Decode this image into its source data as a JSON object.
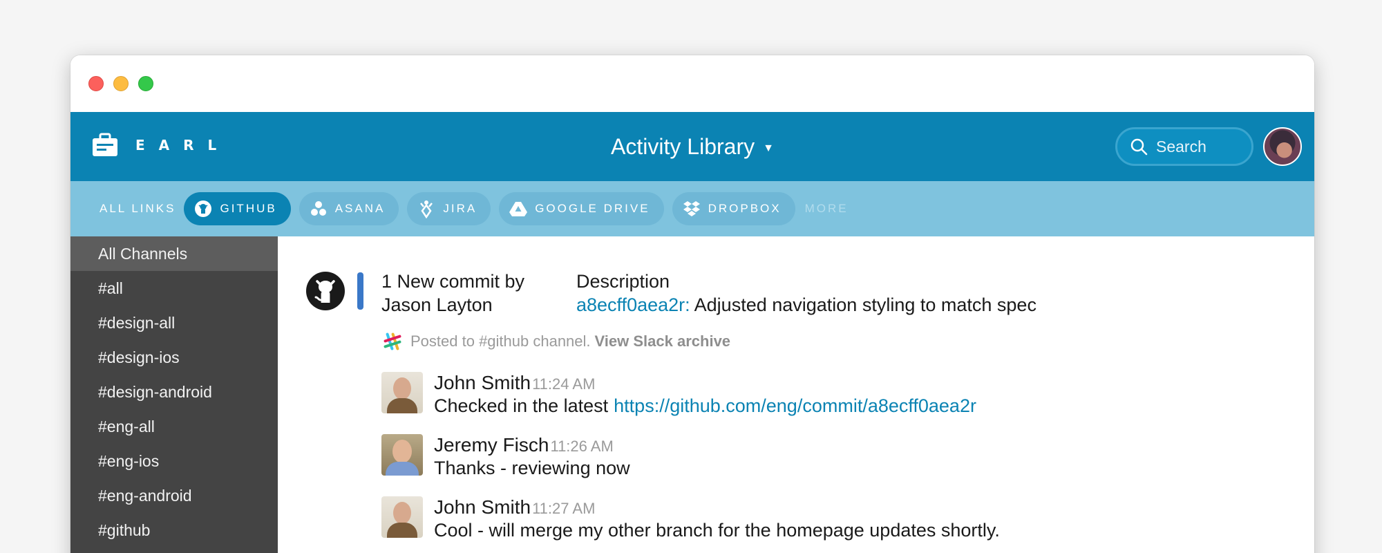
{
  "app": {
    "name": "EARL",
    "title": "Activity Library"
  },
  "search": {
    "placeholder": "Search"
  },
  "links": {
    "all_label": "ALL LINKS",
    "items": [
      {
        "label": "GITHUB",
        "icon": "github-icon",
        "active": true
      },
      {
        "label": "ASANA",
        "icon": "asana-icon"
      },
      {
        "label": "JIRA",
        "icon": "jira-icon"
      },
      {
        "label": "GOOGLE DRIVE",
        "icon": "google-drive-icon"
      },
      {
        "label": "DROPBOX",
        "icon": "dropbox-icon"
      }
    ],
    "more_label": "MORE"
  },
  "sidebar": {
    "items": [
      {
        "label": "All Channels",
        "active": true
      },
      {
        "label": "#all"
      },
      {
        "label": "#design-all"
      },
      {
        "label": "#design-ios"
      },
      {
        "label": "#design-android"
      },
      {
        "label": "#eng-all"
      },
      {
        "label": "#eng-ios"
      },
      {
        "label": "#eng-android"
      },
      {
        "label": "#github"
      }
    ]
  },
  "activity": {
    "commit_line1": "1 New commit by",
    "commit_line2": "Jason Layton",
    "desc_label": "Description",
    "hash": "a8ecff0aea2r:",
    "desc_text": "Adjusted navigation styling to match spec",
    "posted_text": "Posted to #github channel.",
    "archive_link": "View Slack archive"
  },
  "messages": [
    {
      "name": "John Smith",
      "time": "11:24 AM",
      "text": "Checked in the latest",
      "link": "https://github.com/eng/commit/a8ecff0aea2r"
    },
    {
      "name": "Jeremy Fisch",
      "time": "11:26 AM",
      "text": "Thanks - reviewing now"
    },
    {
      "name": "John Smith",
      "time": "11:27 AM",
      "text": "Cool - will merge my other branch for the homepage updates shortly."
    }
  ],
  "colors": {
    "header": "#0b83b3",
    "links_bar": "#7fc3de",
    "sidebar": "#444444",
    "link": "#0b83b3"
  }
}
